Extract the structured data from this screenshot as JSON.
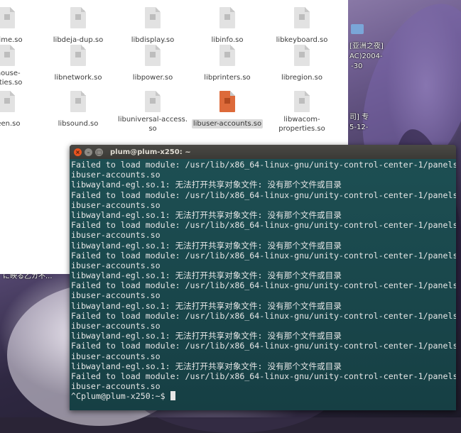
{
  "desktop": {
    "labels": [
      "[亚洲之夜]",
      "AC)2004-",
      "-30",
      "司] 专",
      "5-12-",
      "に映る乙ガ不..."
    ]
  },
  "file_manager": {
    "files": [
      {
        "name": "etime.so",
        "selected": false
      },
      {
        "name": "libdeja-dup.so",
        "selected": false
      },
      {
        "name": "libdisplay.so",
        "selected": false
      },
      {
        "name": "libinfo.so",
        "selected": false
      },
      {
        "name": "libkeyboard.so",
        "selected": false
      },
      {
        "name": "mouse-\nerties.so",
        "selected": false
      },
      {
        "name": "libnetwork.so",
        "selected": false
      },
      {
        "name": "libpower.so",
        "selected": false
      },
      {
        "name": "libprinters.so",
        "selected": false
      },
      {
        "name": "libregion.so",
        "selected": false
      },
      {
        "name": "reen.so",
        "selected": false
      },
      {
        "name": "libsound.so",
        "selected": false
      },
      {
        "name": "libuniversal-access.\nso",
        "selected": false
      },
      {
        "name": "libuser-accounts.so",
        "selected": true
      },
      {
        "name": "libwacom-\nproperties.so",
        "selected": false
      }
    ]
  },
  "terminal": {
    "title": "plum@plum-x250: ~",
    "lines": [
      "Failed to load module: /usr/lib/x86_64-linux-gnu/unity-control-center-1/panels/l",
      "ibuser-accounts.so",
      "libwayland-egl.so.1: 无法打开共享对象文件: 没有那个文件或目录",
      "Failed to load module: /usr/lib/x86_64-linux-gnu/unity-control-center-1/panels/l",
      "ibuser-accounts.so",
      "libwayland-egl.so.1: 无法打开共享对象文件: 没有那个文件或目录",
      "Failed to load module: /usr/lib/x86_64-linux-gnu/unity-control-center-1/panels/l",
      "ibuser-accounts.so",
      "libwayland-egl.so.1: 无法打开共享对象文件: 没有那个文件或目录",
      "Failed to load module: /usr/lib/x86_64-linux-gnu/unity-control-center-1/panels/l",
      "ibuser-accounts.so",
      "libwayland-egl.so.1: 无法打开共享对象文件: 没有那个文件或目录",
      "Failed to load module: /usr/lib/x86_64-linux-gnu/unity-control-center-1/panels/l",
      "ibuser-accounts.so",
      "libwayland-egl.so.1: 无法打开共享对象文件: 没有那个文件或目录",
      "Failed to load module: /usr/lib/x86_64-linux-gnu/unity-control-center-1/panels/l",
      "ibuser-accounts.so",
      "libwayland-egl.so.1: 无法打开共享对象文件: 没有那个文件或目录",
      "Failed to load module: /usr/lib/x86_64-linux-gnu/unity-control-center-1/panels/l",
      "ibuser-accounts.so",
      "libwayland-egl.so.1: 无法打开共享对象文件: 没有那个文件或目录",
      "Failed to load module: /usr/lib/x86_64-linux-gnu/unity-control-center-1/panels/l",
      "ibuser-accounts.so"
    ],
    "prompt": "^Cplum@plum-x250:~$ "
  }
}
